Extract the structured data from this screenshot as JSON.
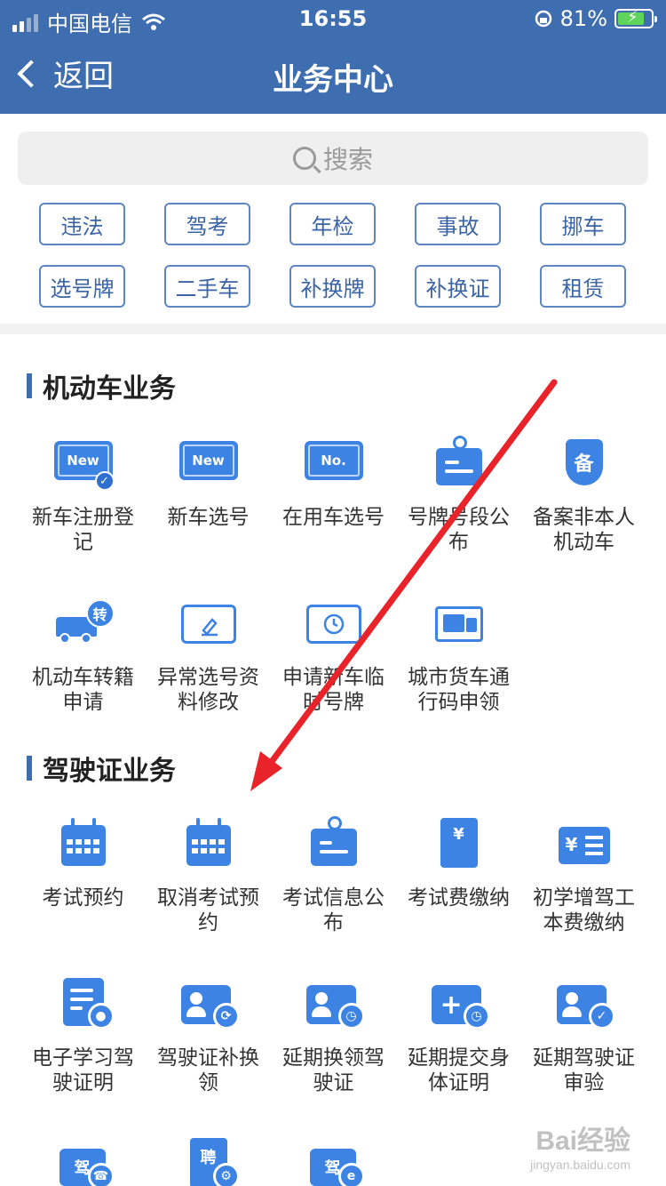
{
  "status_bar": {
    "carrier": "中国电信",
    "time": "16:55",
    "battery": "81%",
    "battery_level": 0.81
  },
  "nav": {
    "back_label": "返回",
    "title": "业务中心"
  },
  "search": {
    "placeholder": "搜索"
  },
  "quick_tags": [
    "违法",
    "驾考",
    "年检",
    "事故",
    "挪车",
    "选号牌",
    "二手车",
    "补换牌",
    "补换证",
    "租赁"
  ],
  "section_vehicle": {
    "title": "机动车业务",
    "items": [
      {
        "label": "新车注册登记",
        "icon": "new-plate-check-icon",
        "icon_text": "New"
      },
      {
        "label": "新车选号",
        "icon": "new-plate-icon",
        "icon_text": "New"
      },
      {
        "label": "在用车选号",
        "icon": "number-plate-icon",
        "icon_text": "No."
      },
      {
        "label": "号牌号段公布",
        "icon": "plate-announcement-icon",
        "icon_text": ""
      },
      {
        "label": "备案非本人机动车",
        "icon": "record-shield-icon",
        "icon_text": "备"
      },
      {
        "label": "机动车转籍申请",
        "icon": "vehicle-transfer-icon",
        "icon_text": "转"
      },
      {
        "label": "异常选号资料修改",
        "icon": "edit-plate-icon",
        "icon_text": ""
      },
      {
        "label": "申请新车临时号牌",
        "icon": "temporary-plate-icon",
        "icon_text": ""
      },
      {
        "label": "城市货车通行码申领",
        "icon": "truck-pass-icon",
        "icon_text": ""
      }
    ]
  },
  "section_license": {
    "title": "驾驶证业务",
    "items": [
      {
        "label": "考试预约",
        "icon": "calendar-icon",
        "icon_text": ""
      },
      {
        "label": "取消考试预约",
        "icon": "calendar-cancel-icon",
        "icon_text": ""
      },
      {
        "label": "考试信息公布",
        "icon": "exam-announcement-icon",
        "icon_text": ""
      },
      {
        "label": "考试费缴纳",
        "icon": "fee-receipt-icon",
        "icon_text": "¥"
      },
      {
        "label": "初学增驾工本费缴纳",
        "icon": "fee-card-icon",
        "icon_text": "¥"
      },
      {
        "label": "电子学习驾驶证明",
        "icon": "study-document-icon",
        "icon_text": ""
      },
      {
        "label": "驾驶证补换领",
        "icon": "license-replace-icon",
        "icon_text": ""
      },
      {
        "label": "延期换领驾驶证",
        "icon": "license-delay-icon",
        "icon_text": ""
      },
      {
        "label": "延期提交身体证明",
        "icon": "health-delay-icon",
        "icon_text": "+"
      },
      {
        "label": "延期驾驶证审验",
        "icon": "license-verify-icon",
        "icon_text": ""
      },
      {
        "label": "",
        "icon": "driving-call-icon",
        "icon_text": "驾"
      },
      {
        "label": "",
        "icon": "hire-settings-icon",
        "icon_text": "聘"
      },
      {
        "label": "",
        "icon": "driving-online-icon",
        "icon_text": "驾"
      }
    ]
  },
  "colors": {
    "brand": "#3f6eb0",
    "icon": "#3c83e3",
    "arrow": "#e8232a"
  },
  "watermark": {
    "text": "Bai经验",
    "url": "jingyan.baidu.com"
  }
}
